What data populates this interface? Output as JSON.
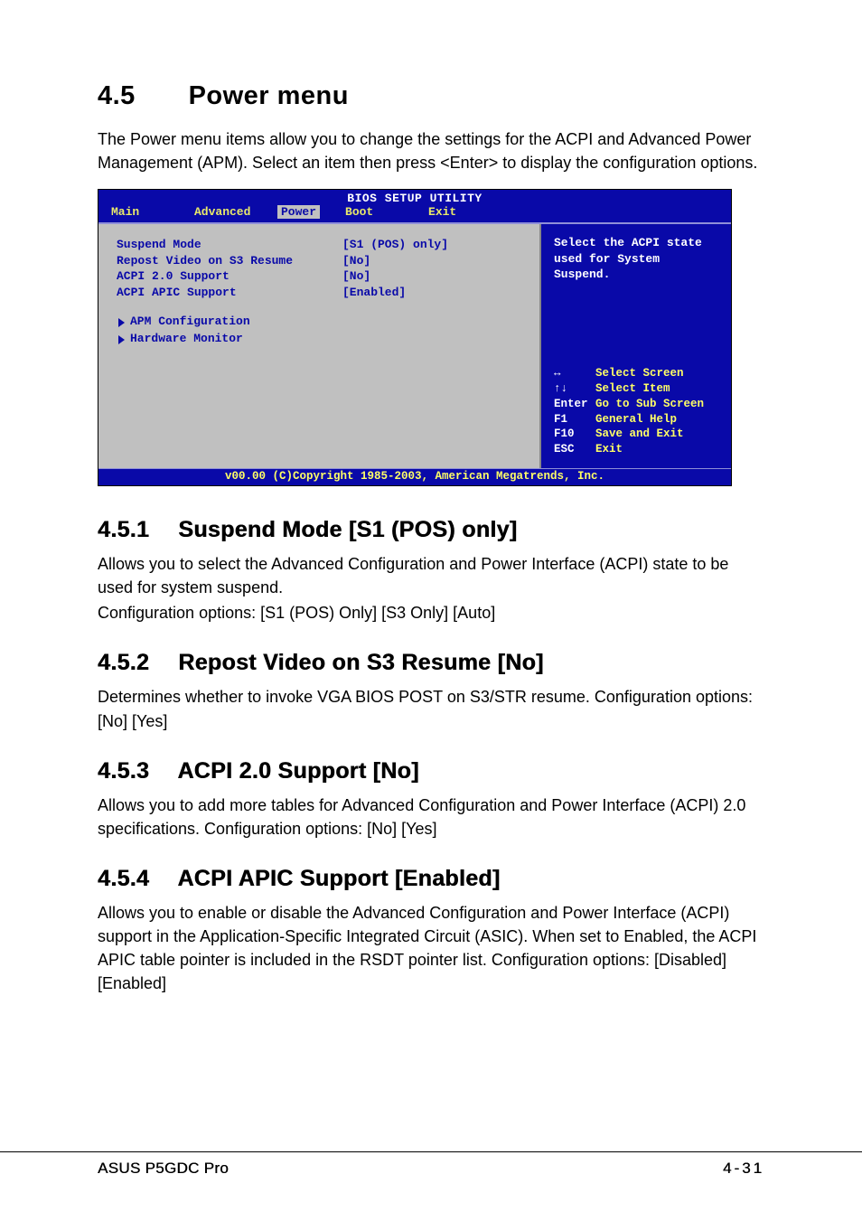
{
  "heading": {
    "number": "4.5",
    "title": "Power menu"
  },
  "intro": "The Power menu items allow you to change the settings for the ACPI and Advanced Power Management (APM). Select an item then press <Enter> to display the configuration options.",
  "bios": {
    "title": "BIOS SETUP UTILITY",
    "tabs": [
      "Main",
      "Advanced",
      "Power",
      "Boot",
      "Exit"
    ],
    "active_tab": "Power",
    "items": [
      {
        "label": "Suspend Mode",
        "value": "[S1 (POS) only]"
      },
      {
        "label": "Repost Video on S3 Resume",
        "value": "[No]"
      },
      {
        "label": "ACPI 2.0 Support",
        "value": "[No]"
      },
      {
        "label": "ACPI APIC Support",
        "value": "[Enabled]"
      }
    ],
    "submenus": [
      "APM Configuration",
      "Hardware Monitor"
    ],
    "help": "Select the ACPI state used for System Suspend.",
    "keys": [
      {
        "key": "↔",
        "desc": "Select Screen"
      },
      {
        "key": "↑↓",
        "desc": "Select Item"
      },
      {
        "key": "Enter",
        "desc": "Go to Sub Screen"
      },
      {
        "key": "F1",
        "desc": "General Help"
      },
      {
        "key": "F10",
        "desc": "Save and Exit"
      },
      {
        "key": "ESC",
        "desc": "Exit"
      }
    ],
    "footer": "v00.00 (C)Copyright 1985-2003, American Megatrends, Inc."
  },
  "sections": [
    {
      "number": "4.5.1",
      "title": "Suspend Mode [S1 (POS) only]",
      "paragraphs": [
        "Allows you to select the Advanced Configuration and Power Interface (ACPI) state to be used for system suspend.",
        "Configuration options: [S1 (POS) Only] [S3 Only] [Auto]"
      ]
    },
    {
      "number": "4.5.2",
      "title": "Repost Video on S3 Resume [No]",
      "paragraphs": [
        "Determines whether to invoke VGA BIOS POST on S3/STR resume. Configuration options: [No] [Yes]"
      ]
    },
    {
      "number": "4.5.3",
      "title": "ACPI 2.0 Support [No]",
      "paragraphs": [
        "Allows you to add more tables for Advanced Configuration and Power Interface (ACPI) 2.0 specifications. Configuration options: [No] [Yes]"
      ]
    },
    {
      "number": "4.5.4",
      "title": "ACPI APIC Support [Enabled]",
      "paragraphs": [
        "Allows you to enable or disable the Advanced Configuration and Power Interface (ACPI) support in the Application-Specific Integrated Circuit (ASIC). When set to Enabled, the ACPI APIC table pointer is included in the RSDT pointer list. Configuration options: [Disabled] [Enabled]"
      ]
    }
  ],
  "footer": {
    "left": "ASUS P5GDC Pro",
    "right": "4-31"
  }
}
